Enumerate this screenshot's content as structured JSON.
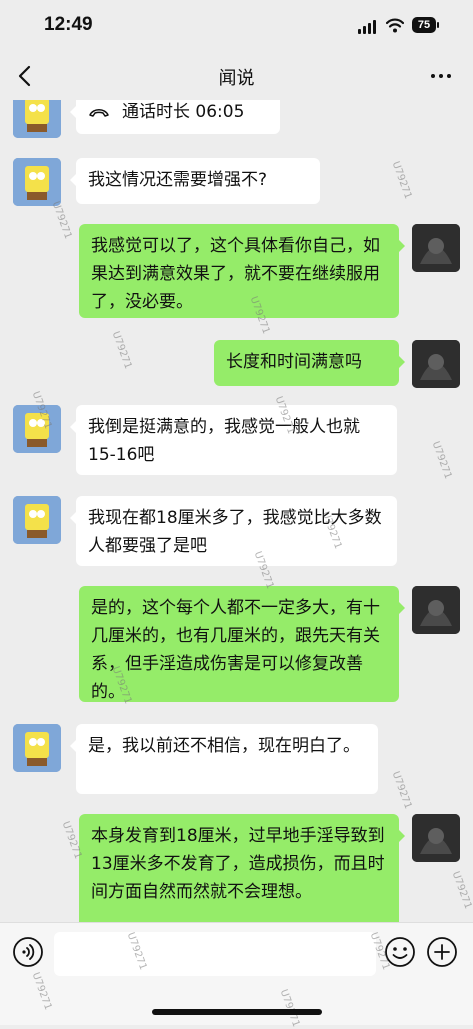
{
  "status": {
    "time": "12:49",
    "battery": "75"
  },
  "nav": {
    "title": "闻说"
  },
  "messages": [
    {
      "side": "left",
      "call": true,
      "text": "通话时长 06:05"
    },
    {
      "side": "left",
      "text": "我这情况还需要增强不?"
    },
    {
      "side": "right",
      "text": "我感觉可以了，这个具体看你自己，如果达到满意效果了，就不要在继续服用了，没必要。"
    },
    {
      "side": "right",
      "text": "长度和时间满意吗"
    },
    {
      "side": "left",
      "text": "我倒是挺满意的，我感觉一般人也就15-16吧"
    },
    {
      "side": "left",
      "text": "我现在都18厘米多了，我感觉比大多数人都要强了是吧"
    },
    {
      "side": "right",
      "text": "是的，这个每个人都不一定多大，有十几厘米的，也有几厘米的，跟先天有关系，但手淫造成伤害是可以修复改善的。"
    },
    {
      "side": "left",
      "text": "是，我以前还不相信，现在明白了。"
    },
    {
      "side": "right",
      "text": "本身发育到18厘米，过早地手淫导致到13厘米多不发育了，造成损伤，而且时间方面自然而然就不会理想。"
    }
  ],
  "watermark": "U79271",
  "colors": {
    "bubble_right": "#95ec69",
    "bubble_left": "#ffffff",
    "background": "#ededed"
  },
  "icons": {
    "back": "chevron-left-icon",
    "more": "more-icon",
    "voice": "voice-icon",
    "emoji": "emoji-icon",
    "plus": "plus-icon",
    "call": "phone-hangup-icon"
  }
}
